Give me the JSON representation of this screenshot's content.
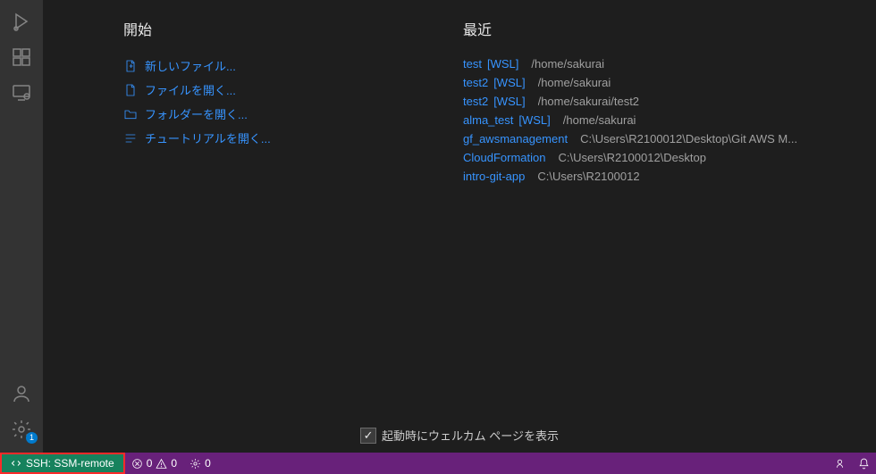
{
  "start": {
    "heading": "開始",
    "items": [
      {
        "label": "新しいファイル...",
        "icon": "new-file-icon"
      },
      {
        "label": "ファイルを開く...",
        "icon": "open-file-icon"
      },
      {
        "label": "フォルダーを開く...",
        "icon": "open-folder-icon"
      },
      {
        "label": "チュートリアルを開く...",
        "icon": "walkthrough-icon"
      }
    ]
  },
  "recent": {
    "heading": "最近",
    "items": [
      {
        "name": "test",
        "tag": "[WSL]",
        "path": "/home/sakurai"
      },
      {
        "name": "test2",
        "tag": "[WSL]",
        "path": "/home/sakurai"
      },
      {
        "name": "test2",
        "tag": "[WSL]",
        "path": "/home/sakurai/test2"
      },
      {
        "name": "alma_test",
        "tag": "[WSL]",
        "path": "/home/sakurai"
      },
      {
        "name": "gf_awsmanagement",
        "tag": "",
        "path": "C:\\Users\\R2100012\\Desktop\\Git AWS M..."
      },
      {
        "name": "CloudFormation",
        "tag": "",
        "path": "C:\\Users\\R2100012\\Desktop"
      },
      {
        "name": "intro-git-app",
        "tag": "",
        "path": "C:\\Users\\R2100012"
      }
    ]
  },
  "welcome_footer": {
    "checkbox_label": "起動時にウェルカム ページを表示",
    "checked": true
  },
  "status": {
    "remote_label": "SSH: SSM-remote",
    "errors": "0",
    "warnings": "0",
    "ports": "0"
  },
  "activity": {
    "settings_badge": "1"
  }
}
